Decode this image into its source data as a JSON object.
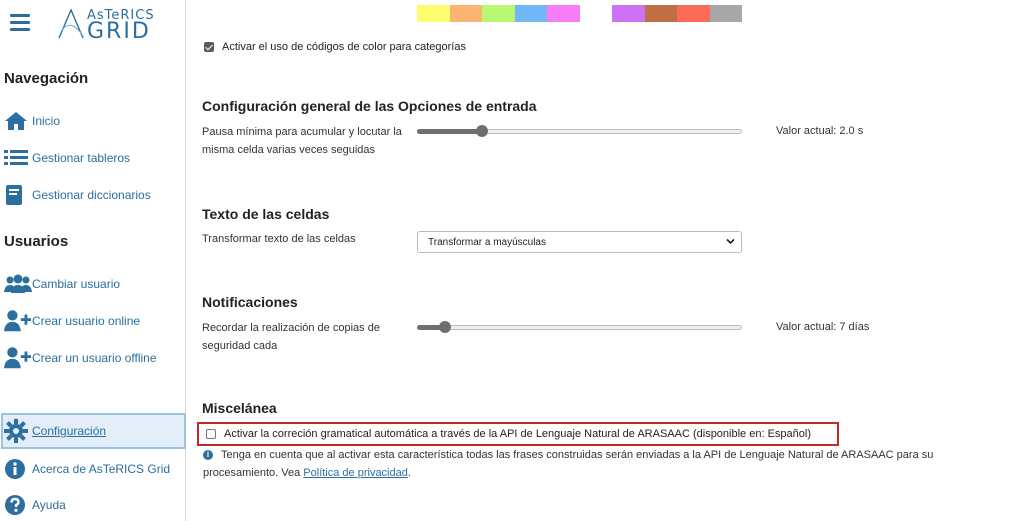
{
  "app": {
    "logo_top": "AsTeRICS",
    "logo_main": "GRID"
  },
  "sidebar": {
    "nav_title": "Navegación",
    "nav_items": [
      {
        "label": "Inicio",
        "icon": "home-icon"
      },
      {
        "label": "Gestionar tableros",
        "icon": "list-icon"
      },
      {
        "label": "Gestionar diccionarios",
        "icon": "book-icon"
      }
    ],
    "users_title": "Usuarios",
    "user_items": [
      {
        "label": "Cambiar usuario",
        "icon": "users-icon"
      },
      {
        "label": "Crear usuario online",
        "icon": "user-plus-icon"
      },
      {
        "label": "Crear un usuario offline",
        "icon": "user-plus-icon"
      }
    ],
    "bottom_items": [
      {
        "label": "Configuración",
        "icon": "gear-icon",
        "active": true
      },
      {
        "label": "Acerca de AsTeRICS Grid",
        "icon": "info-icon"
      },
      {
        "label": "Ayuda",
        "icon": "help-icon"
      }
    ]
  },
  "colors": {
    "accent": "#2c6e9e",
    "swatches_group1": [
      "#fbfd6f",
      "#fbb472",
      "#b9f873",
      "#71b8fb",
      "#f87cf6"
    ],
    "swatches_group2": [
      "#cd72f5",
      "#c26e45",
      "#fc6a58",
      "#a7a7a7"
    ]
  },
  "settings": {
    "color_coding_label": "Activar el uso de códigos de color para categorías",
    "color_coding_checked": true,
    "input_section_title": "Configuración general de las Opciones de entrada",
    "pause_label": "Pausa mínima para acumular y locutar la misma celda varias veces seguidas",
    "pause_value_text": "Valor actual: 2.0 s",
    "pause_slider_fraction": 0.2,
    "cell_text_title": "Texto de las celdas",
    "transform_label": "Transformar texto de las celdas",
    "transform_selected": "Transformar a mayúsculas",
    "notifications_title": "Notificaciones",
    "backup_label": "Recordar la realización de copias de seguridad cada",
    "backup_value_text": "Valor actual: 7 días",
    "backup_slider_fraction": 0.085,
    "misc_title": "Miscelánea",
    "grammar_label": "Activar la correción gramatical automática a través de la API de Lenguaje Natural de ARASAAC (disponible en: Español)",
    "grammar_checked": false,
    "info_text": "Tenga en cuenta que al activar esta característica todas las frases construidas serán enviadas a la API de Lenguaje Natural de ARASAAC para su procesamiento. Vea ",
    "privacy_link": "Política de privacidad",
    "info_end": "."
  }
}
